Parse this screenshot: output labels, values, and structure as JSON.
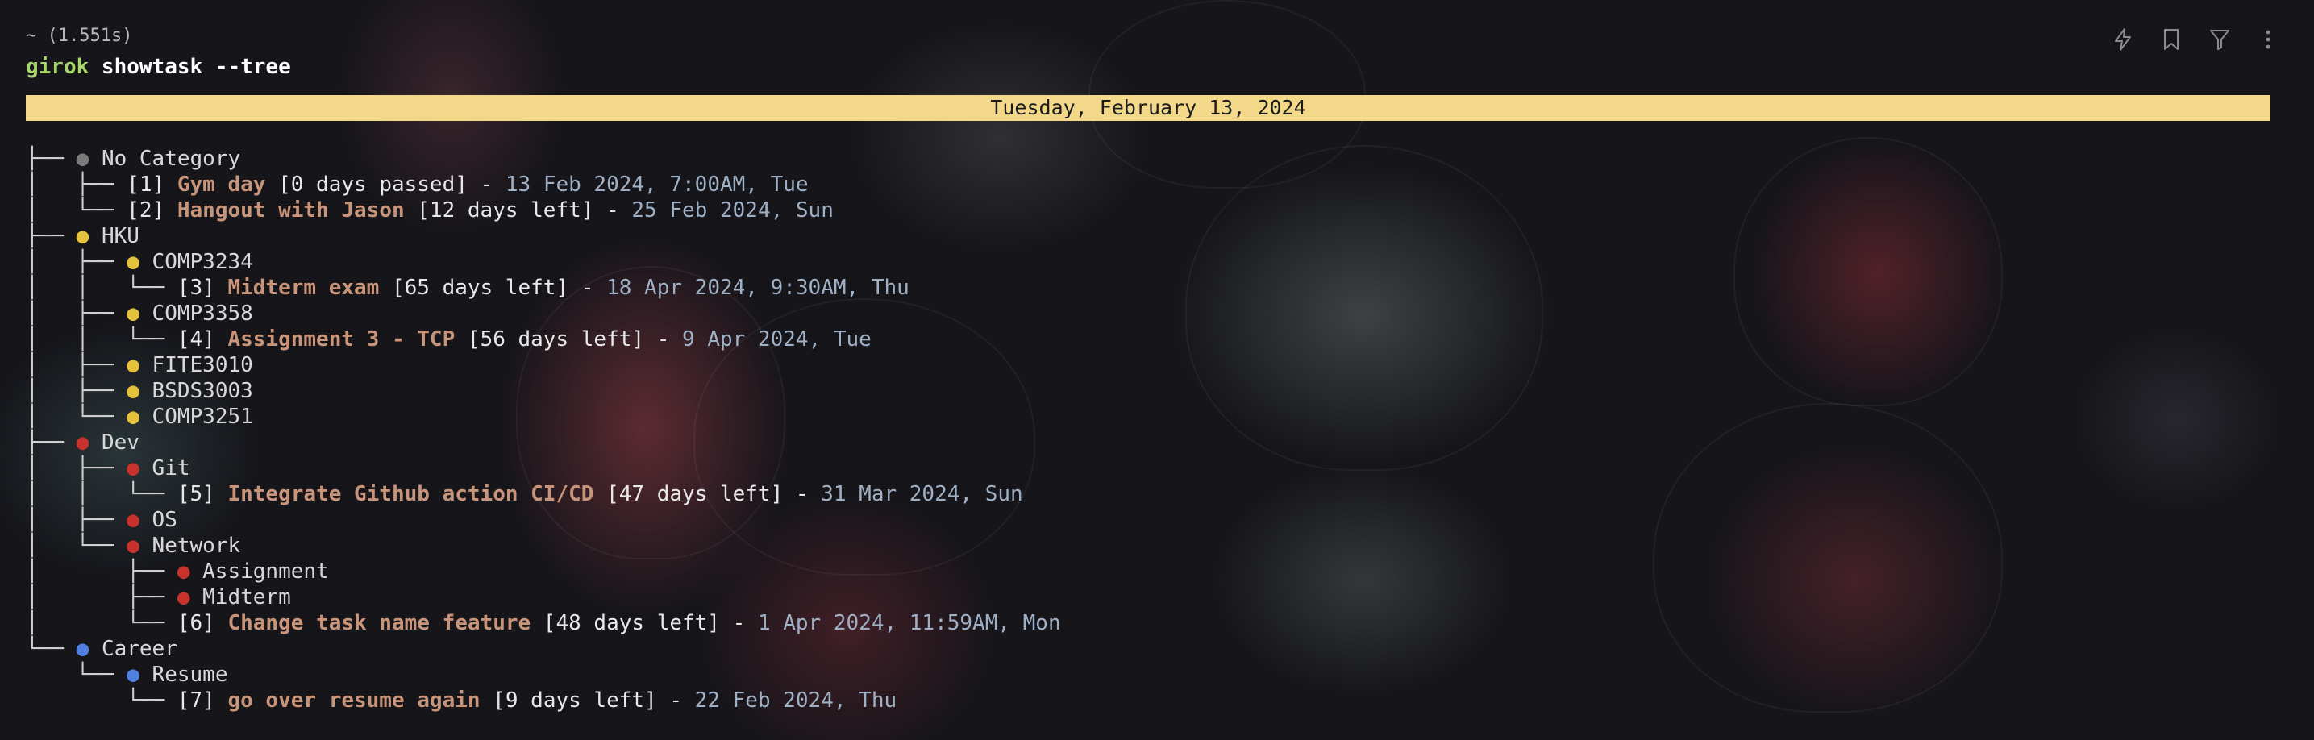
{
  "terminal": {
    "meta": "~ (1.551s)",
    "command_prog": "girok",
    "command_args": " showtask --tree",
    "date_banner": "Tuesday, February 13, 2024"
  },
  "toolbar": {
    "icons": [
      "lightning-icon",
      "bookmark-icon",
      "filter-icon",
      "more-vertical-icon"
    ]
  },
  "colors": {
    "gray": "#7a7a7a",
    "yellow": "#e4c23c",
    "red": "#c9322c",
    "blue": "#4f7fe0",
    "task_name": "#c9957a",
    "date_text": "#9fb0c4",
    "banner_bg": "#f3d88a"
  },
  "tree": [
    {
      "kind": "cat",
      "guide": "├── ",
      "color": "#7a7a7a",
      "label": "No Category"
    },
    {
      "kind": "task",
      "guide": "│   ├── ",
      "id": "[1] ",
      "name": "Gym day",
      "remaining": " [0 days passed]",
      "sep": " - ",
      "date": "13 Feb 2024, 7:00AM, Tue"
    },
    {
      "kind": "task",
      "guide": "│   └── ",
      "id": "[2] ",
      "name": "Hangout with Jason",
      "remaining": " [12 days left]",
      "sep": " - ",
      "date": "25 Feb 2024, Sun"
    },
    {
      "kind": "cat",
      "guide": "├── ",
      "color": "#e4c23c",
      "label": "HKU"
    },
    {
      "kind": "cat",
      "guide": "│   ├── ",
      "color": "#e4c23c",
      "label": "COMP3234"
    },
    {
      "kind": "task",
      "guide": "│   │   └── ",
      "id": "[3] ",
      "name": "Midterm exam",
      "remaining": " [65 days left]",
      "sep": " - ",
      "date": "18 Apr 2024, 9:30AM, Thu"
    },
    {
      "kind": "cat",
      "guide": "│   ├── ",
      "color": "#e4c23c",
      "label": "COMP3358"
    },
    {
      "kind": "task",
      "guide": "│   │   └── ",
      "id": "[4] ",
      "name": "Assignment 3 - TCP",
      "remaining": " [56 days left]",
      "sep": " - ",
      "date": "9 Apr 2024, Tue"
    },
    {
      "kind": "cat",
      "guide": "│   ├── ",
      "color": "#e4c23c",
      "label": "FITE3010"
    },
    {
      "kind": "cat",
      "guide": "│   ├── ",
      "color": "#e4c23c",
      "label": "BSDS3003"
    },
    {
      "kind": "cat",
      "guide": "│   └── ",
      "color": "#e4c23c",
      "label": "COMP3251"
    },
    {
      "kind": "cat",
      "guide": "├── ",
      "color": "#c9322c",
      "label": "Dev"
    },
    {
      "kind": "cat",
      "guide": "│   ├── ",
      "color": "#c9322c",
      "label": "Git"
    },
    {
      "kind": "task",
      "guide": "│   │   └── ",
      "id": "[5] ",
      "name": "Integrate Github action CI/CD",
      "remaining": " [47 days left]",
      "sep": " - ",
      "date": "31 Mar 2024, Sun"
    },
    {
      "kind": "cat",
      "guide": "│   ├── ",
      "color": "#c9322c",
      "label": "OS"
    },
    {
      "kind": "cat",
      "guide": "│   └── ",
      "color": "#c9322c",
      "label": "Network"
    },
    {
      "kind": "cat",
      "guide": "│       ├── ",
      "color": "#c9322c",
      "label": "Assignment"
    },
    {
      "kind": "cat",
      "guide": "│       ├── ",
      "color": "#c9322c",
      "label": "Midterm"
    },
    {
      "kind": "task",
      "guide": "│       └── ",
      "id": "[6] ",
      "name": "Change task name feature",
      "remaining": " [48 days left]",
      "sep": " - ",
      "date": "1 Apr 2024, 11:59AM, Mon"
    },
    {
      "kind": "cat",
      "guide": "└── ",
      "color": "#4f7fe0",
      "label": "Career"
    },
    {
      "kind": "cat",
      "guide": "    └── ",
      "color": "#4f7fe0",
      "label": "Resume"
    },
    {
      "kind": "task",
      "guide": "        └── ",
      "id": "[7] ",
      "name": "go over resume again",
      "remaining": " [9 days left]",
      "sep": " - ",
      "date": "22 Feb 2024, Thu"
    }
  ]
}
